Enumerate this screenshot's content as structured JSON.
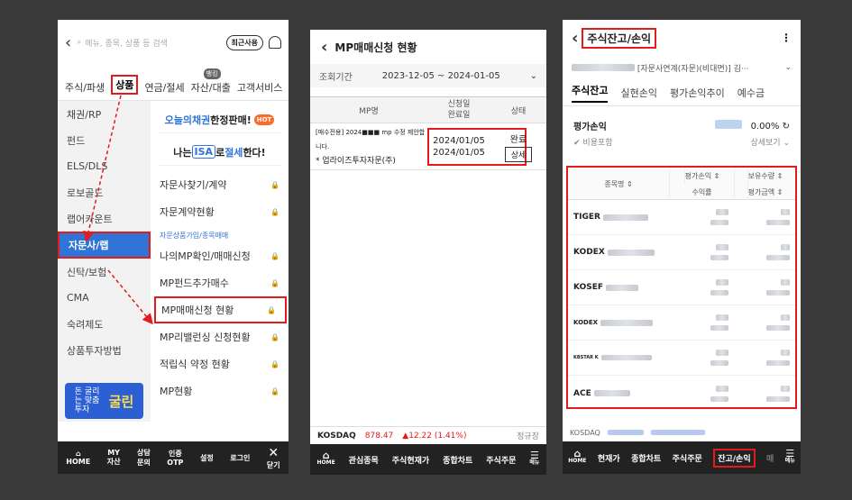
{
  "phone1": {
    "search_placeholder": "메뉴, 종목, 상품 등 검색",
    "recent_label": "최근사용",
    "tabs": [
      "주식/파생",
      "상품",
      "연금/절세",
      "자산/대출",
      "고객서비스"
    ],
    "tab_badge": "뱅킹",
    "categories": [
      "채권/RP",
      "펀드",
      "ELS/DLS",
      "로보골드",
      "랩어카운트",
      "자문사/랩",
      "신탁/보험",
      "CMA",
      "숙려제도",
      "상품투자방법"
    ],
    "banner_text": "돈 굴리는 맞춤 투자",
    "banner_brand": "굴린",
    "promo1_blue": "오늘의채권",
    "promo1_rest": " 한정판매!",
    "hot": "HOT",
    "promo2_pre": "나는 ",
    "promo2_isa": "ISA",
    "promo2_mid": "로 ",
    "promo2_blue": "절세",
    "promo2_post": "한다!",
    "menu_top": [
      "자문사찾기/계약",
      "자문계약현황"
    ],
    "section_label": "자문상품가입/종목매매",
    "menu_bottom": [
      "나의MP확인/매매신청",
      "MP펀드추가매수",
      "MP매매신청 현황",
      "MP리밸런싱 신청현황",
      "적립식 약정 현황",
      "MP현황"
    ],
    "bottom_bar": [
      [
        "HOME",
        ""
      ],
      [
        "MY",
        "자산"
      ],
      [
        "상담",
        "문의"
      ],
      [
        "인증",
        "OTP"
      ],
      [
        "설정",
        ""
      ],
      [
        "로그인",
        ""
      ],
      [
        "✕",
        "닫기"
      ]
    ]
  },
  "phone2": {
    "title": "MP매매신청 현황",
    "period_label": "조회기간",
    "period_value": "2023-12-05 ~ 2024-01-05",
    "col_mp": "MP명",
    "col_dates_1": "신청일",
    "col_dates_2": "완료일",
    "col_status": "상태",
    "row_name": "[매수전용] 2024■■■ mp 수정 제안합니다.",
    "row_advisor": "* 업라이즈투자자문(주)",
    "row_date1": "2024/01/05",
    "row_date2": "2024/01/05",
    "row_status": "완료",
    "row_detail": "상세",
    "ticker_name": "KOSDAQ",
    "ticker_value": "878.47",
    "ticker_change": "▲12.22 (1.41%)",
    "ticker_tag": "정규장",
    "bottom_bar": [
      "관심종목",
      "주식현재가",
      "종합차트",
      "주식주문"
    ],
    "home": "HOME",
    "menu": "메뉴"
  },
  "phone3": {
    "title": "주식잔고/손익",
    "account_suffix": "[자문사연계(자문)(비대면)] 김···",
    "tabs": [
      "주식잔고",
      "실현손익",
      "평가손익추이",
      "예수금"
    ],
    "pl_label": "평가손익",
    "pl_value": "0.00%",
    "fee_label": "비용포함",
    "detail_label": "상세보기",
    "col_name": "종목명",
    "col_pl": "평가손익",
    "col_qty": "보유수량",
    "col_rate": "수익률",
    "col_amount": "평가금액",
    "stocks": [
      "TIGER",
      "KODEX",
      "KOSEF",
      "KODEX",
      "KBSTAR K",
      "ACE"
    ],
    "ticker_label": "KOSDAQ",
    "bottom_bar": [
      "현재가",
      "종합차트",
      "주식주문",
      "잔고/손익",
      "매"
    ],
    "home": "HOME",
    "menu": "메뉴"
  }
}
